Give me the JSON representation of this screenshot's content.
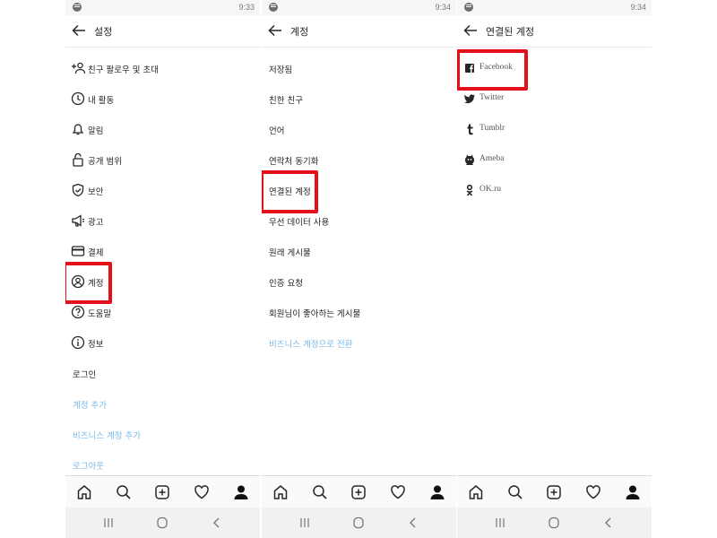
{
  "panels": [
    {
      "time": "9:33",
      "title": "설정",
      "items": [
        {
          "label": "친구 팔로우 및 초대",
          "icon": "add-person-icon"
        },
        {
          "label": "내 활동",
          "icon": "activity-clock-icon"
        },
        {
          "label": "알림",
          "icon": "bell-icon"
        },
        {
          "label": "공개 범위",
          "icon": "lock-icon"
        },
        {
          "label": "보안",
          "icon": "shield-icon"
        },
        {
          "label": "광고",
          "icon": "megaphone-icon"
        },
        {
          "label": "결제",
          "icon": "card-icon"
        },
        {
          "label": "계정",
          "icon": "account-icon",
          "highlighted": true
        },
        {
          "label": "도움말",
          "icon": "help-icon"
        },
        {
          "label": "정보",
          "icon": "info-icon"
        },
        {
          "label": "로그인"
        },
        {
          "label": "계정 추가",
          "link": true
        },
        {
          "label": "비즈니스 계정 추가",
          "link": true
        },
        {
          "label": "로그아웃",
          "link": true
        }
      ]
    },
    {
      "time": "9:34",
      "title": "계정",
      "items": [
        {
          "label": "저장됨"
        },
        {
          "label": "친한 친구"
        },
        {
          "label": "언어"
        },
        {
          "label": "연락처 동기화"
        },
        {
          "label": "연결된 계정",
          "highlighted": true
        },
        {
          "label": "무선 데이터 사용"
        },
        {
          "label": "원래 게시물"
        },
        {
          "label": "인증 요청"
        },
        {
          "label": "회원님이 좋아하는 게시물"
        },
        {
          "label": "비즈니스 계정으로 전환",
          "link": true
        }
      ]
    },
    {
      "time": "9:34",
      "title": "연결된 계정",
      "items": [
        {
          "label": "Facebook",
          "icon": "facebook-icon",
          "highlighted": true
        },
        {
          "label": "Twitter",
          "icon": "twitter-icon"
        },
        {
          "label": "Tumblr",
          "icon": "tumblr-icon"
        },
        {
          "label": "Ameba",
          "icon": "ameba-icon"
        },
        {
          "label": "OK.ru",
          "icon": "okru-icon"
        }
      ]
    }
  ],
  "tab_icons": [
    "home-icon",
    "search-icon",
    "add-post-icon",
    "heart-icon",
    "profile-icon"
  ],
  "nav_icons": [
    "recent-apps-icon",
    "home-circle-icon",
    "back-chevron-icon"
  ],
  "colors": {
    "highlight": "#e3101a",
    "link": "#7cb9e8",
    "text": "#262626"
  }
}
